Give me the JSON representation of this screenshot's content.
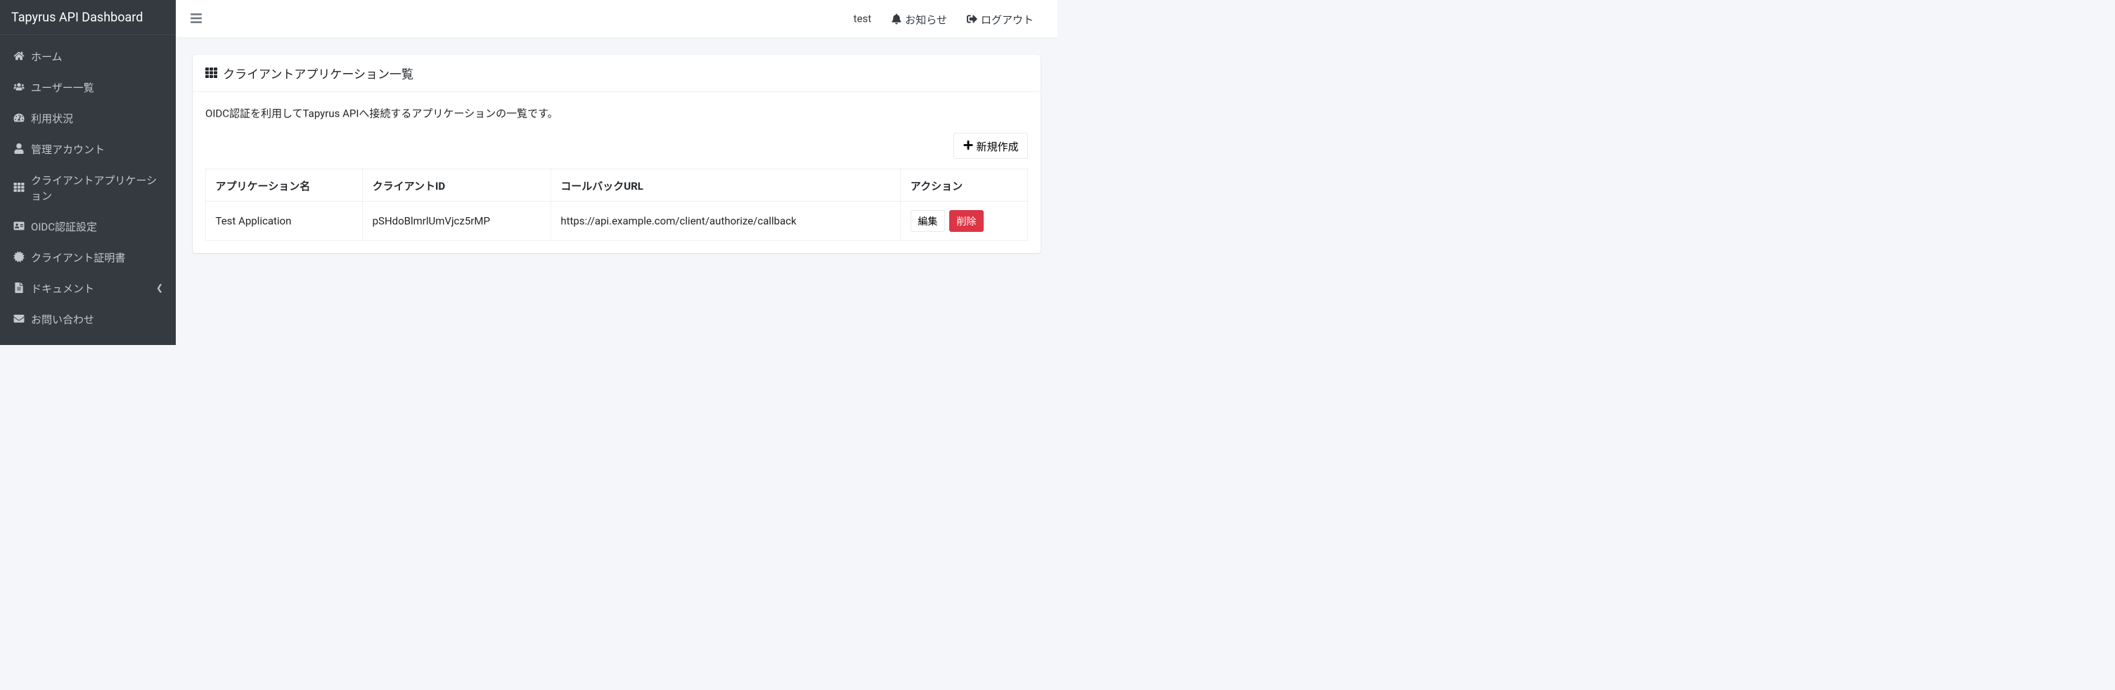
{
  "brand": "Tapyrus API Dashboard",
  "sidebar": {
    "items": [
      {
        "icon": "home-icon",
        "label": "ホーム"
      },
      {
        "icon": "users-icon",
        "label": "ユーザー一覧"
      },
      {
        "icon": "dashboard-icon",
        "label": "利用状況"
      },
      {
        "icon": "user-icon",
        "label": "管理アカウント"
      },
      {
        "icon": "grid-icon",
        "label": "クライアントアプリケーション"
      },
      {
        "icon": "id-card-icon",
        "label": "OIDC認証設定"
      },
      {
        "icon": "certificate-icon",
        "label": "クライアント証明書"
      },
      {
        "icon": "file-icon",
        "label": "ドキュメント",
        "has_submenu": true
      },
      {
        "icon": "envelope-icon",
        "label": "お問い合わせ"
      }
    ]
  },
  "topbar": {
    "username": "test",
    "notifications_label": "お知らせ",
    "logout_label": "ログアウト"
  },
  "page": {
    "title": "クライアントアプリケーション一覧",
    "description": "OIDC認証を利用してTapyrus APIへ接続するアプリケーションの一覧です。",
    "create_button": "新規作成"
  },
  "table": {
    "headers": {
      "name": "アプリケーション名",
      "client_id": "クライアントID",
      "callback_url": "コールバックURL",
      "actions": "アクション"
    },
    "rows": [
      {
        "name": "Test Application",
        "client_id": "pSHdoBlmrlUmVjcz5rMP",
        "callback_url": "https://api.example.com/client/authorize/callback"
      }
    ],
    "edit_label": "編集",
    "delete_label": "削除"
  }
}
